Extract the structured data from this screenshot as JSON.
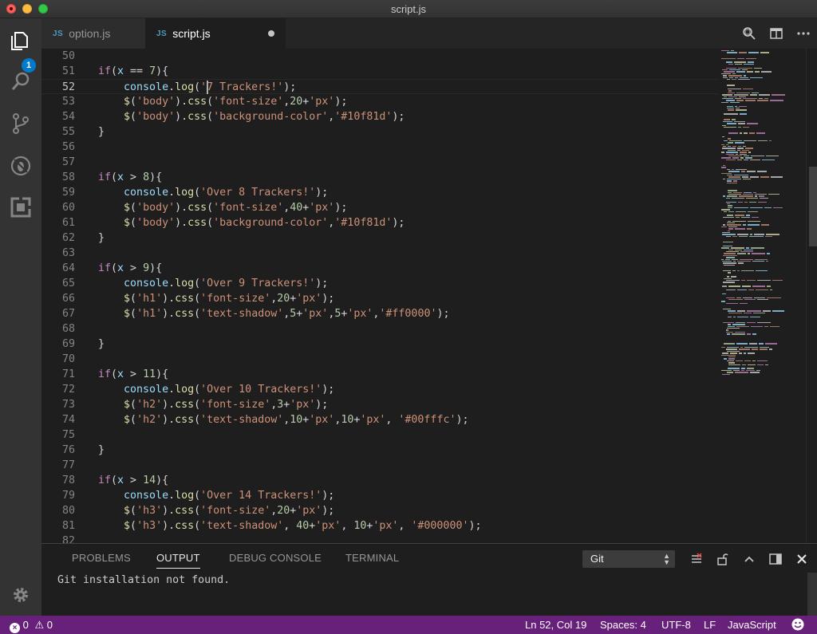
{
  "window": {
    "title": "script.js"
  },
  "activity_bar": {
    "explorer_badge": "1"
  },
  "tabs": [
    {
      "icon_label": "JS",
      "label": "option.js",
      "active": false
    },
    {
      "icon_label": "JS",
      "label": "script.js",
      "active": true,
      "dirty": true
    }
  ],
  "editor": {
    "current_line": "52",
    "lines": [
      {
        "n": "50",
        "tokens": []
      },
      {
        "n": "51",
        "tokens": [
          [
            "kw",
            "if"
          ],
          [
            "p",
            "("
          ],
          [
            "var",
            "x"
          ],
          [
            "p",
            " == "
          ],
          [
            "num",
            "7"
          ],
          [
            "p",
            "){"
          ]
        ]
      },
      {
        "n": "52",
        "tokens": [
          [
            "p",
            "    "
          ],
          [
            "var",
            "console"
          ],
          [
            "p",
            "."
          ],
          [
            "fn",
            "log"
          ],
          [
            "p",
            "("
          ],
          [
            "str",
            "'7 Trackers!'"
          ],
          [
            "p",
            ");"
          ]
        ]
      },
      {
        "n": "53",
        "tokens": [
          [
            "p",
            "    "
          ],
          [
            "fn",
            "$"
          ],
          [
            "p",
            "("
          ],
          [
            "str",
            "'body'"
          ],
          [
            "p",
            ")."
          ],
          [
            "fn",
            "css"
          ],
          [
            "p",
            "("
          ],
          [
            "str",
            "'font-size'"
          ],
          [
            "p",
            ","
          ],
          [
            "num",
            "20"
          ],
          [
            "p",
            "+"
          ],
          [
            "str",
            "'px'"
          ],
          [
            "p",
            ");"
          ]
        ]
      },
      {
        "n": "54",
        "tokens": [
          [
            "p",
            "    "
          ],
          [
            "fn",
            "$"
          ],
          [
            "p",
            "("
          ],
          [
            "str",
            "'body'"
          ],
          [
            "p",
            ")."
          ],
          [
            "fn",
            "css"
          ],
          [
            "p",
            "("
          ],
          [
            "str",
            "'background-color'"
          ],
          [
            "p",
            ","
          ],
          [
            "str",
            "'#10f81d'"
          ],
          [
            "p",
            ");"
          ]
        ]
      },
      {
        "n": "55",
        "tokens": [
          [
            "p",
            "}"
          ]
        ]
      },
      {
        "n": "56",
        "tokens": []
      },
      {
        "n": "57",
        "tokens": []
      },
      {
        "n": "58",
        "tokens": [
          [
            "kw",
            "if"
          ],
          [
            "p",
            "("
          ],
          [
            "var",
            "x"
          ],
          [
            "p",
            " > "
          ],
          [
            "num",
            "8"
          ],
          [
            "p",
            "){"
          ]
        ]
      },
      {
        "n": "59",
        "tokens": [
          [
            "p",
            "    "
          ],
          [
            "var",
            "console"
          ],
          [
            "p",
            "."
          ],
          [
            "fn",
            "log"
          ],
          [
            "p",
            "("
          ],
          [
            "str",
            "'Over 8 Trackers!'"
          ],
          [
            "p",
            ");"
          ]
        ]
      },
      {
        "n": "60",
        "tokens": [
          [
            "p",
            "    "
          ],
          [
            "fn",
            "$"
          ],
          [
            "p",
            "("
          ],
          [
            "str",
            "'body'"
          ],
          [
            "p",
            ")."
          ],
          [
            "fn",
            "css"
          ],
          [
            "p",
            "("
          ],
          [
            "str",
            "'font-size'"
          ],
          [
            "p",
            ","
          ],
          [
            "num",
            "40"
          ],
          [
            "p",
            "+"
          ],
          [
            "str",
            "'px'"
          ],
          [
            "p",
            ");"
          ]
        ]
      },
      {
        "n": "61",
        "tokens": [
          [
            "p",
            "    "
          ],
          [
            "fn",
            "$"
          ],
          [
            "p",
            "("
          ],
          [
            "str",
            "'body'"
          ],
          [
            "p",
            ")."
          ],
          [
            "fn",
            "css"
          ],
          [
            "p",
            "("
          ],
          [
            "str",
            "'background-color'"
          ],
          [
            "p",
            ","
          ],
          [
            "str",
            "'#10f81d'"
          ],
          [
            "p",
            ");"
          ]
        ]
      },
      {
        "n": "62",
        "tokens": [
          [
            "p",
            "}"
          ]
        ]
      },
      {
        "n": "63",
        "tokens": []
      },
      {
        "n": "64",
        "tokens": [
          [
            "kw",
            "if"
          ],
          [
            "p",
            "("
          ],
          [
            "var",
            "x"
          ],
          [
            "p",
            " > "
          ],
          [
            "num",
            "9"
          ],
          [
            "p",
            "){"
          ]
        ]
      },
      {
        "n": "65",
        "tokens": [
          [
            "p",
            "    "
          ],
          [
            "var",
            "console"
          ],
          [
            "p",
            "."
          ],
          [
            "fn",
            "log"
          ],
          [
            "p",
            "("
          ],
          [
            "str",
            "'Over 9 Trackers!'"
          ],
          [
            "p",
            ");"
          ]
        ]
      },
      {
        "n": "66",
        "tokens": [
          [
            "p",
            "    "
          ],
          [
            "fn",
            "$"
          ],
          [
            "p",
            "("
          ],
          [
            "str",
            "'h1'"
          ],
          [
            "p",
            ")."
          ],
          [
            "fn",
            "css"
          ],
          [
            "p",
            "("
          ],
          [
            "str",
            "'font-size'"
          ],
          [
            "p",
            ","
          ],
          [
            "num",
            "20"
          ],
          [
            "p",
            "+"
          ],
          [
            "str",
            "'px'"
          ],
          [
            "p",
            ");"
          ]
        ]
      },
      {
        "n": "67",
        "tokens": [
          [
            "p",
            "    "
          ],
          [
            "fn",
            "$"
          ],
          [
            "p",
            "("
          ],
          [
            "str",
            "'h1'"
          ],
          [
            "p",
            ")."
          ],
          [
            "fn",
            "css"
          ],
          [
            "p",
            "("
          ],
          [
            "str",
            "'text-shadow'"
          ],
          [
            "p",
            ","
          ],
          [
            "num",
            "5"
          ],
          [
            "p",
            "+"
          ],
          [
            "str",
            "'px'"
          ],
          [
            "p",
            ","
          ],
          [
            "num",
            "5"
          ],
          [
            "p",
            "+"
          ],
          [
            "str",
            "'px'"
          ],
          [
            "p",
            ","
          ],
          [
            "str",
            "'#ff0000'"
          ],
          [
            "p",
            ");"
          ]
        ]
      },
      {
        "n": "68",
        "tokens": []
      },
      {
        "n": "69",
        "tokens": [
          [
            "p",
            "}"
          ]
        ]
      },
      {
        "n": "70",
        "tokens": []
      },
      {
        "n": "71",
        "tokens": [
          [
            "kw",
            "if"
          ],
          [
            "p",
            "("
          ],
          [
            "var",
            "x"
          ],
          [
            "p",
            " > "
          ],
          [
            "num",
            "11"
          ],
          [
            "p",
            "){"
          ]
        ]
      },
      {
        "n": "72",
        "tokens": [
          [
            "p",
            "    "
          ],
          [
            "var",
            "console"
          ],
          [
            "p",
            "."
          ],
          [
            "fn",
            "log"
          ],
          [
            "p",
            "("
          ],
          [
            "str",
            "'Over 10 Trackers!'"
          ],
          [
            "p",
            ");"
          ]
        ]
      },
      {
        "n": "73",
        "tokens": [
          [
            "p",
            "    "
          ],
          [
            "fn",
            "$"
          ],
          [
            "p",
            "("
          ],
          [
            "str",
            "'h2'"
          ],
          [
            "p",
            ")."
          ],
          [
            "fn",
            "css"
          ],
          [
            "p",
            "("
          ],
          [
            "str",
            "'font-size'"
          ],
          [
            "p",
            ","
          ],
          [
            "num",
            "3"
          ],
          [
            "p",
            "+"
          ],
          [
            "str",
            "'px'"
          ],
          [
            "p",
            ");"
          ]
        ]
      },
      {
        "n": "74",
        "tokens": [
          [
            "p",
            "    "
          ],
          [
            "fn",
            "$"
          ],
          [
            "p",
            "("
          ],
          [
            "str",
            "'h2'"
          ],
          [
            "p",
            ")."
          ],
          [
            "fn",
            "css"
          ],
          [
            "p",
            "("
          ],
          [
            "str",
            "'text-shadow'"
          ],
          [
            "p",
            ","
          ],
          [
            "num",
            "10"
          ],
          [
            "p",
            "+"
          ],
          [
            "str",
            "'px'"
          ],
          [
            "p",
            ","
          ],
          [
            "num",
            "10"
          ],
          [
            "p",
            "+"
          ],
          [
            "str",
            "'px'"
          ],
          [
            "p",
            ", "
          ],
          [
            "str",
            "'#00fffc'"
          ],
          [
            "p",
            ");"
          ]
        ]
      },
      {
        "n": "75",
        "tokens": []
      },
      {
        "n": "76",
        "tokens": [
          [
            "p",
            "}"
          ]
        ]
      },
      {
        "n": "77",
        "tokens": []
      },
      {
        "n": "78",
        "tokens": [
          [
            "kw",
            "if"
          ],
          [
            "p",
            "("
          ],
          [
            "var",
            "x"
          ],
          [
            "p",
            " > "
          ],
          [
            "num",
            "14"
          ],
          [
            "p",
            "){"
          ]
        ]
      },
      {
        "n": "79",
        "tokens": [
          [
            "p",
            "    "
          ],
          [
            "var",
            "console"
          ],
          [
            "p",
            "."
          ],
          [
            "fn",
            "log"
          ],
          [
            "p",
            "("
          ],
          [
            "str",
            "'Over 14 Trackers!'"
          ],
          [
            "p",
            ");"
          ]
        ]
      },
      {
        "n": "80",
        "tokens": [
          [
            "p",
            "    "
          ],
          [
            "fn",
            "$"
          ],
          [
            "p",
            "("
          ],
          [
            "str",
            "'h3'"
          ],
          [
            "p",
            ")."
          ],
          [
            "fn",
            "css"
          ],
          [
            "p",
            "("
          ],
          [
            "str",
            "'font-size'"
          ],
          [
            "p",
            ","
          ],
          [
            "num",
            "20"
          ],
          [
            "p",
            "+"
          ],
          [
            "str",
            "'px'"
          ],
          [
            "p",
            ");"
          ]
        ]
      },
      {
        "n": "81",
        "tokens": [
          [
            "p",
            "    "
          ],
          [
            "fn",
            "$"
          ],
          [
            "p",
            "("
          ],
          [
            "str",
            "'h3'"
          ],
          [
            "p",
            ")."
          ],
          [
            "fn",
            "css"
          ],
          [
            "p",
            "("
          ],
          [
            "str",
            "'text-shadow'"
          ],
          [
            "p",
            ", "
          ],
          [
            "num",
            "40"
          ],
          [
            "p",
            "+"
          ],
          [
            "str",
            "'px'"
          ],
          [
            "p",
            ", "
          ],
          [
            "num",
            "10"
          ],
          [
            "p",
            "+"
          ],
          [
            "str",
            "'px'"
          ],
          [
            "p",
            ", "
          ],
          [
            "str",
            "'#000000'"
          ],
          [
            "p",
            ");"
          ]
        ]
      },
      {
        "n": "82",
        "tokens": []
      }
    ]
  },
  "panel": {
    "tabs": [
      "PROBLEMS",
      "OUTPUT",
      "DEBUG CONSOLE",
      "TERMINAL"
    ],
    "active_tab": "OUTPUT",
    "channel_select": "Git",
    "output": "Git installation not found."
  },
  "status_bar": {
    "errors": "0",
    "warnings": "0",
    "position": "Ln 52, Col 19",
    "indent": "Spaces: 4",
    "encoding": "UTF-8",
    "eol": "LF",
    "language": "JavaScript"
  },
  "colors": {
    "status_bar": "#68217a",
    "activity_bar": "#333333",
    "editor_bg": "#1e1e1e",
    "badge": "#007acc",
    "keyword": "#c586c0",
    "string": "#ce9178",
    "number": "#b5cea8",
    "function": "#dcdcaa",
    "variable": "#9cdcfe"
  },
  "icons": [
    "explorer-icon",
    "search-icon",
    "source-control-icon",
    "debug-icon",
    "extensions-icon",
    "settings-gear-icon",
    "open-changes-icon",
    "split-editor-icon",
    "more-icon",
    "clear-output-icon",
    "lock-scroll-icon",
    "maximize-panel-icon",
    "toggle-panel-icon",
    "close-panel-icon",
    "error-icon",
    "warning-icon",
    "feedback-smiley-icon"
  ]
}
